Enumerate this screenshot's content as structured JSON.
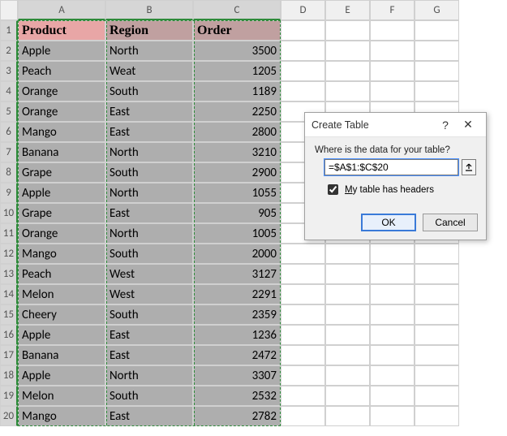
{
  "columns": [
    "A",
    "B",
    "C",
    "D",
    "E",
    "F",
    "G"
  ],
  "headers": [
    "Product",
    "Region",
    "Order"
  ],
  "rows": [
    {
      "product": "Apple",
      "region": "North",
      "order": 3500
    },
    {
      "product": "Peach",
      "region": "Weat",
      "order": 1205
    },
    {
      "product": "Orange",
      "region": "South",
      "order": 1189
    },
    {
      "product": "Orange",
      "region": "East",
      "order": 2250
    },
    {
      "product": "Mango",
      "region": "East",
      "order": 2800
    },
    {
      "product": "Banana",
      "region": "North",
      "order": 3210
    },
    {
      "product": "Grape",
      "region": "South",
      "order": 2900
    },
    {
      "product": "Apple",
      "region": "North",
      "order": 1055
    },
    {
      "product": "Grape",
      "region": "East",
      "order": 905
    },
    {
      "product": "Orange",
      "region": "North",
      "order": 1005
    },
    {
      "product": "Mango",
      "region": "South",
      "order": 2000
    },
    {
      "product": "Peach",
      "region": "West",
      "order": 3127
    },
    {
      "product": "Melon",
      "region": "West",
      "order": 2291
    },
    {
      "product": "Cheery",
      "region": "South",
      "order": 2359
    },
    {
      "product": "Apple",
      "region": "East",
      "order": 1236
    },
    {
      "product": "Banana",
      "region": "East",
      "order": 2472
    },
    {
      "product": "Apple",
      "region": "North",
      "order": 3307
    },
    {
      "product": "Melon",
      "region": "South",
      "order": 2532
    },
    {
      "product": "Mango",
      "region": "East",
      "order": 2782
    }
  ],
  "dialog": {
    "title": "Create Table",
    "help_icon": "?",
    "close_icon": "✕",
    "prompt": "Where is the data for your table?",
    "range_value": "=$A$1:$C$20",
    "ref_icon": "⬆",
    "checkbox_checked": true,
    "checkbox_label_u": "M",
    "checkbox_label_rest": "y table has headers",
    "ok_label": "OK",
    "cancel_label": "Cancel"
  }
}
